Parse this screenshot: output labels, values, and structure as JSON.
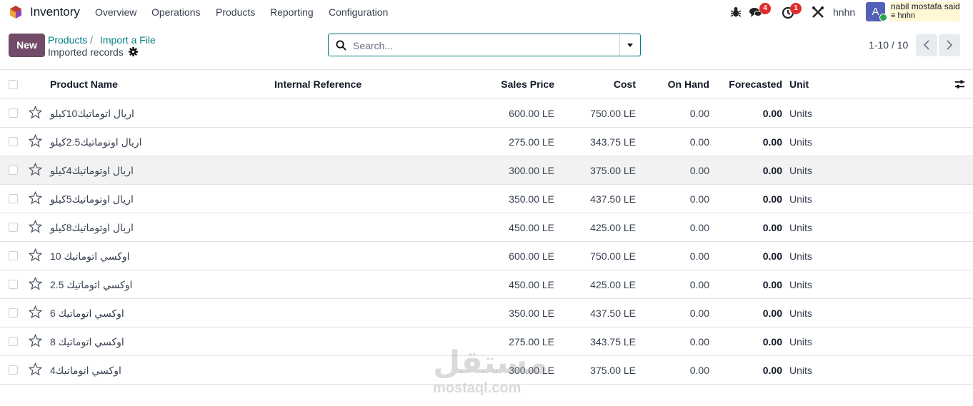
{
  "header": {
    "app_name": "Inventory",
    "menu": [
      "Overview",
      "Operations",
      "Products",
      "Reporting",
      "Configuration"
    ],
    "messages_badge": "4",
    "activities_badge": "1",
    "db_name": "hnhn",
    "avatar_letter": "A",
    "user_name": "nabil mostafa said",
    "user_db": "hnhn"
  },
  "control": {
    "new_label": "New",
    "breadcrumb": [
      "Products",
      "Import a File"
    ],
    "breadcrumb_sep": "/",
    "subtitle": "Imported records",
    "search_placeholder": "Search...",
    "pager": "1-10 / 10"
  },
  "columns": {
    "name": "Product Name",
    "ref": "Internal Reference",
    "price": "Sales Price",
    "cost": "Cost",
    "onhand": "On Hand",
    "forecast": "Forecasted",
    "unit": "Units_hdr"
  },
  "rows": [
    {
      "name": "اريال اتوماتيك10كيلو",
      "price": "600.00 LE",
      "cost": "750.00 LE",
      "onhand": "0.00",
      "forecast": "0.00",
      "unit": "Units"
    },
    {
      "name": "اريال اوتوماتيك2.5كيلو",
      "price": "275.00 LE",
      "cost": "343.75 LE",
      "onhand": "0.00",
      "forecast": "0.00",
      "unit": "Units"
    },
    {
      "name": "اريال اوتوماتيك4كيلو",
      "price": "300.00 LE",
      "cost": "375.00 LE",
      "onhand": "0.00",
      "forecast": "0.00",
      "unit": "Units"
    },
    {
      "name": "اريال اوتوماتيك5كيلو",
      "price": "350.00 LE",
      "cost": "437.50 LE",
      "onhand": "0.00",
      "forecast": "0.00",
      "unit": "Units"
    },
    {
      "name": "اريال اوتوماتيك8كيلو",
      "price": "450.00 LE",
      "cost": "425.00 LE",
      "onhand": "0.00",
      "forecast": "0.00",
      "unit": "Units"
    },
    {
      "name": "اوكسي اتوماتيك 10",
      "price": "600.00 LE",
      "cost": "750.00 LE",
      "onhand": "0.00",
      "forecast": "0.00",
      "unit": "Units"
    },
    {
      "name": "اوكسي اتوماتيك 2.5",
      "price": "450.00 LE",
      "cost": "425.00 LE",
      "onhand": "0.00",
      "forecast": "0.00",
      "unit": "Units"
    },
    {
      "name": "اوكسي اتوماتيك 6",
      "price": "350.00 LE",
      "cost": "437.50 LE",
      "onhand": "0.00",
      "forecast": "0.00",
      "unit": "Units"
    },
    {
      "name": "اوكسي اتوماتيك 8",
      "price": "275.00 LE",
      "cost": "343.75 LE",
      "onhand": "0.00",
      "forecast": "0.00",
      "unit": "Units"
    },
    {
      "name": "اوكسي اتوماتيك4",
      "price": "300.00 LE",
      "cost": "375.00 LE",
      "onhand": "0.00",
      "forecast": "0.00",
      "unit": "Units"
    }
  ],
  "watermark": {
    "ar": "مستقل",
    "en": "mostaql.com"
  }
}
